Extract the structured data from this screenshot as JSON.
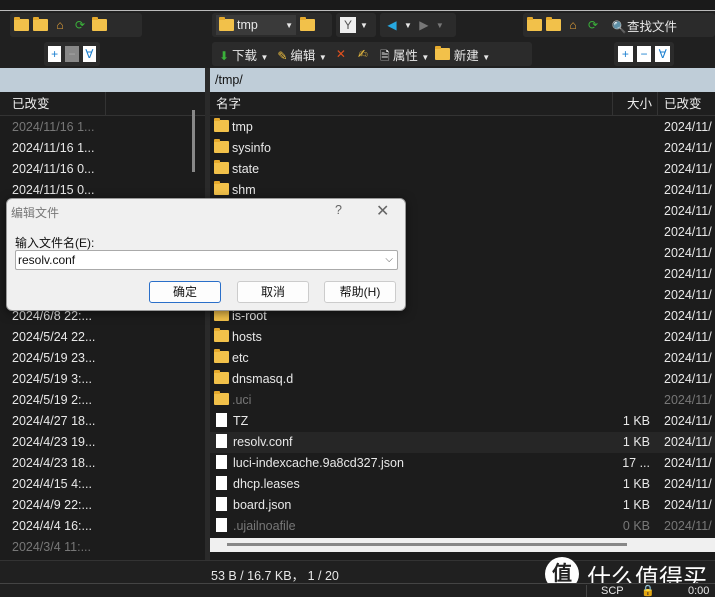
{
  "toolbar": {
    "path_combo": "tmp",
    "find_files": "查找文件",
    "download": "下载",
    "edit": "编辑",
    "properties": "属性",
    "new": "新建"
  },
  "left_panel": {
    "col_changed": "已改变",
    "rows": [
      {
        "date": "2024/11/16 1...",
        "dim": true
      },
      {
        "date": "2024/11/16 1..."
      },
      {
        "date": "2024/11/16 0..."
      },
      {
        "date": "2024/11/15 0..."
      },
      {
        "date": ""
      },
      {
        "date": ""
      },
      {
        "date": ""
      },
      {
        "date": ""
      },
      {
        "date": ""
      },
      {
        "date": "2024/6/8 22:..."
      },
      {
        "date": "2024/5/24 22..."
      },
      {
        "date": "2024/5/19 23..."
      },
      {
        "date": "2024/5/19 3:..."
      },
      {
        "date": "2024/5/19 2:..."
      },
      {
        "date": "2024/4/27 18..."
      },
      {
        "date": "2024/4/23 19..."
      },
      {
        "date": "2024/4/23 18..."
      },
      {
        "date": "2024/4/15 4:..."
      },
      {
        "date": "2024/4/9 22:..."
      },
      {
        "date": "2024/4/4 16:..."
      },
      {
        "date": "2024/3/4 11:...",
        "dim": true
      }
    ]
  },
  "right_panel": {
    "path": "/tmp/",
    "col_name": "名字",
    "col_size": "大小",
    "col_changed": "已改变",
    "rows": [
      {
        "name": "tmp",
        "type": "folder",
        "size": "",
        "date": "2024/11/"
      },
      {
        "name": "sysinfo",
        "type": "folder",
        "size": "",
        "date": "2024/11/"
      },
      {
        "name": "state",
        "type": "folder",
        "size": "",
        "date": "2024/11/"
      },
      {
        "name": "shm",
        "type": "folder",
        "size": "",
        "date": "2024/11/"
      },
      {
        "name": "",
        "type": "hidden",
        "size": "",
        "date": "2024/11/"
      },
      {
        "name": "",
        "type": "hidden",
        "size": "",
        "date": "2024/11/"
      },
      {
        "name": "",
        "type": "hidden",
        "size": "",
        "date": "2024/11/"
      },
      {
        "name": "",
        "type": "hidden",
        "size": "",
        "date": "2024/11/"
      },
      {
        "name": "",
        "type": "hidden",
        "size": "",
        "date": "2024/11/"
      },
      {
        "name": "is-root",
        "type": "folder",
        "size": "",
        "date": "2024/11/"
      },
      {
        "name": "hosts",
        "type": "folder",
        "size": "",
        "date": "2024/11/"
      },
      {
        "name": "etc",
        "type": "folder",
        "size": "",
        "date": "2024/11/"
      },
      {
        "name": "dnsmasq.d",
        "type": "folder",
        "size": "",
        "date": "2024/11/"
      },
      {
        "name": ".uci",
        "type": "folder",
        "size": "",
        "date": "2024/11/",
        "dim": true
      },
      {
        "name": "TZ",
        "type": "file",
        "size": "1 KB",
        "date": "2024/11/"
      },
      {
        "name": "resolv.conf",
        "type": "file",
        "size": "1 KB",
        "date": "2024/11/",
        "selected": true
      },
      {
        "name": "luci-indexcache.9a8cd327.json",
        "type": "file",
        "size": "17 ...",
        "date": "2024/11/"
      },
      {
        "name": "dhcp.leases",
        "type": "file",
        "size": "1 KB",
        "date": "2024/11/"
      },
      {
        "name": "board.json",
        "type": "file",
        "size": "1 KB",
        "date": "2024/11/"
      },
      {
        "name": ".ujailnoafile",
        "type": "file",
        "size": "0 KB",
        "date": "2024/11/",
        "dim": true
      }
    ]
  },
  "status": {
    "selection": "53 B / 16.7 KB， 1 / 20",
    "protocol": "SCP",
    "time": "0:00"
  },
  "watermark": "什么值得买",
  "dialog": {
    "title": "编辑文件",
    "help_glyph": "?",
    "label": "输入文件名(E):",
    "value": "resolv.conf",
    "ok": "确定",
    "cancel": "取消",
    "help": "帮助(H)"
  }
}
